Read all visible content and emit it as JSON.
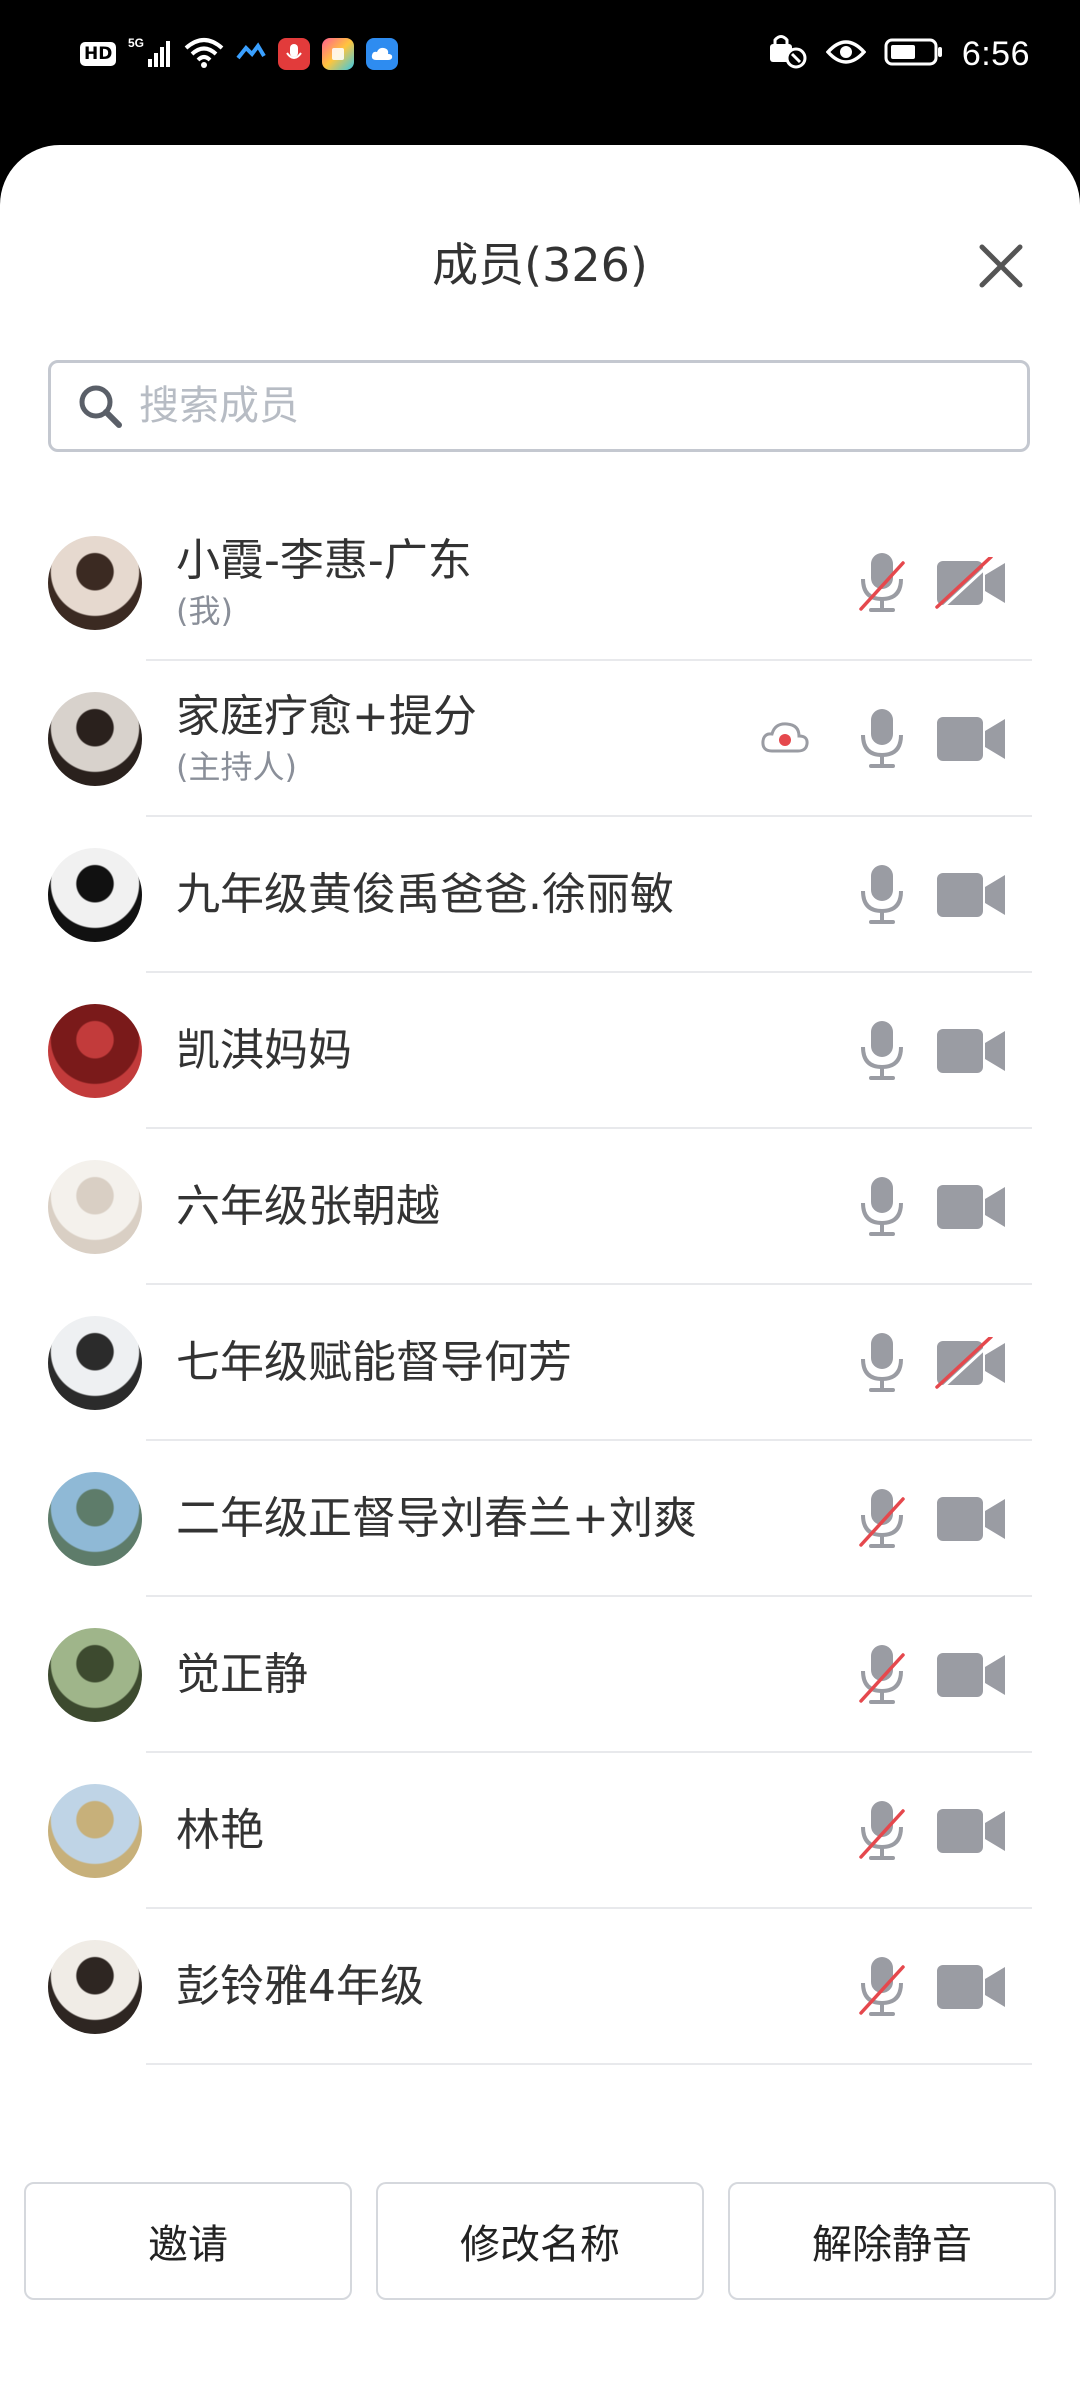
{
  "status_bar": {
    "hd": "HD",
    "signal": "5G",
    "time": "6:56"
  },
  "sheet": {
    "title": "成员(326)",
    "search_placeholder": "搜索成员"
  },
  "members": [
    {
      "name": "小霞-李惠-广东",
      "sub": "(我)",
      "mic": "muted",
      "cam": "off",
      "cloud": false,
      "avatar_colors": [
        "#e6d9cf",
        "#3b2a22"
      ]
    },
    {
      "name": "家庭疗愈+提分",
      "sub": "(主持人)",
      "mic": "on",
      "cam": "on",
      "cloud": true,
      "avatar_colors": [
        "#d8d2cc",
        "#2a211d"
      ]
    },
    {
      "name": "九年级黄俊禹爸爸.徐丽敏",
      "sub": "",
      "mic": "on",
      "cam": "on",
      "cloud": false,
      "avatar_colors": [
        "#f1f1f1",
        "#111111"
      ]
    },
    {
      "name": "凯淇妈妈",
      "sub": "",
      "mic": "on",
      "cam": "on",
      "cloud": false,
      "avatar_colors": [
        "#7a1a1a",
        "#c23b3b"
      ]
    },
    {
      "name": "六年级张朝越",
      "sub": "",
      "mic": "on",
      "cam": "on",
      "cloud": false,
      "avatar_colors": [
        "#f4f1ec",
        "#d9cfc4"
      ]
    },
    {
      "name": "七年级赋能督导何芳",
      "sub": "",
      "mic": "on",
      "cam": "off",
      "cloud": false,
      "avatar_colors": [
        "#eef0f2",
        "#2b2b2b"
      ]
    },
    {
      "name": "二年级正督导刘春兰+刘爽",
      "sub": "",
      "mic": "muted",
      "cam": "on",
      "cloud": false,
      "avatar_colors": [
        "#8fb9d6",
        "#5e7c6a"
      ]
    },
    {
      "name": "觉正静",
      "sub": "",
      "mic": "muted",
      "cam": "on",
      "cloud": false,
      "avatar_colors": [
        "#9fb58a",
        "#3d4a2f"
      ]
    },
    {
      "name": "林艳",
      "sub": "",
      "mic": "muted",
      "cam": "on",
      "cloud": false,
      "avatar_colors": [
        "#bfd4e6",
        "#c7b07a"
      ]
    },
    {
      "name": "彭铃雅4年级",
      "sub": "",
      "mic": "muted",
      "cam": "on",
      "cloud": false,
      "avatar_colors": [
        "#f0ece6",
        "#2e2622"
      ]
    }
  ],
  "buttons": {
    "invite": "邀请",
    "rename": "修改名称",
    "unmute": "解除静音"
  },
  "colors": {
    "icon_gray": "#9a9ca3",
    "mute_red": "#e5484d",
    "divider": "#e8e9ec"
  }
}
